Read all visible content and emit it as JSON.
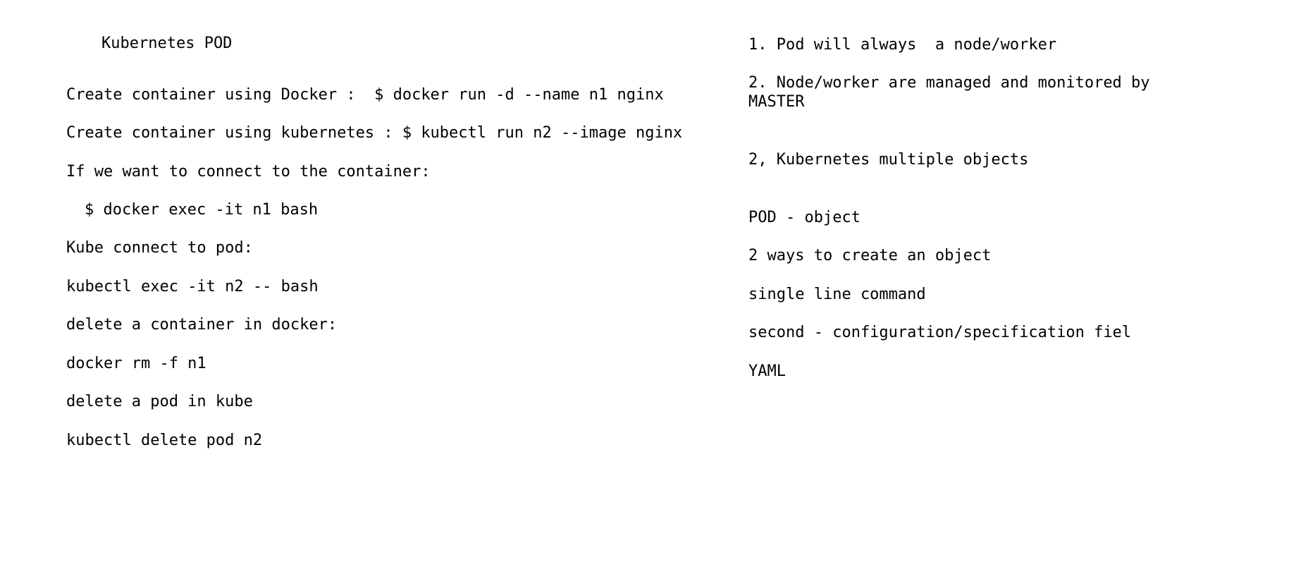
{
  "left_column": {
    "title": "Kubernetes POD",
    "lines": [
      "Create container using Docker :  $ docker run -d --name n1 nginx",
      "Create container using kubernetes : $ kubectl run n2 --image nginx",
      "If we want to connect to the container:",
      "$ docker exec -it n1 bash",
      "Kube connect to pod:",
      "kubectl exec -it n2 -- bash",
      "delete a container in docker:",
      "docker rm -f n1",
      "delete a pod in kube",
      "kubectl delete pod n2"
    ]
  },
  "right_column": {
    "lines": [
      "1. Pod will always  a node/worker",
      "2. Node/worker are managed and monitored by",
      "MASTER",
      "2, Kubernetes multiple objects",
      "POD - object",
      "2 ways to create an object",
      "single line command",
      "second - configuration/specification fiel",
      "YAML"
    ]
  }
}
